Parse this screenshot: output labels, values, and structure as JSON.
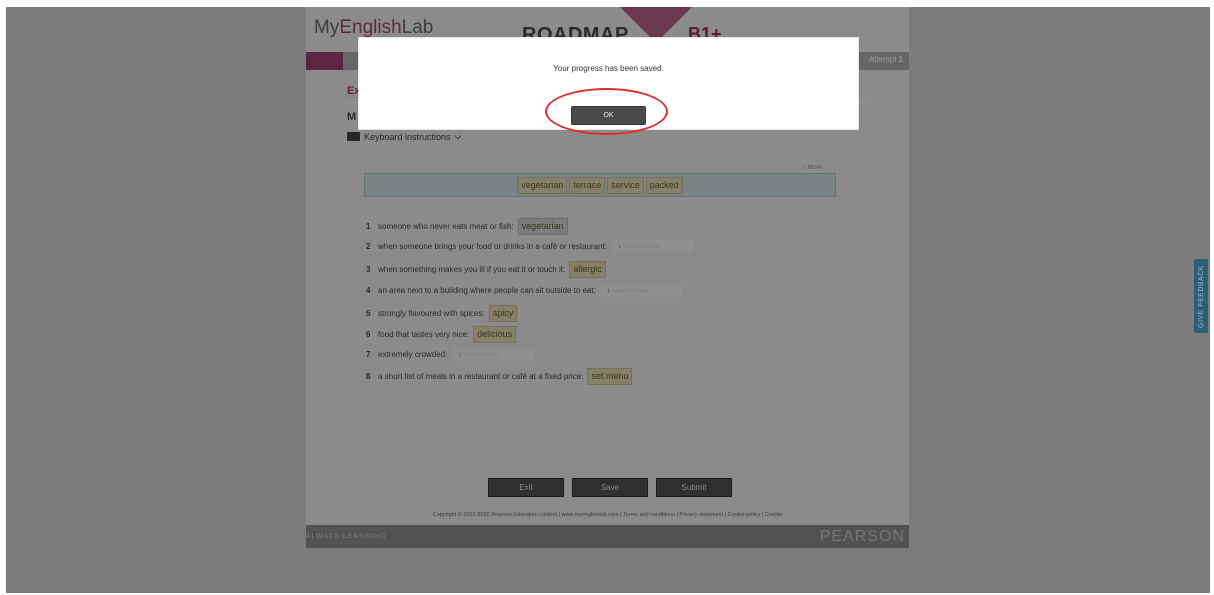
{
  "header": {
    "logo_prefix": "My",
    "logo_accent": "English",
    "logo_suffix": "Lab",
    "course": "ROADMAP",
    "level": "B1+"
  },
  "nav": {
    "attempt_label": "Attempt",
    "attempt_number": "1"
  },
  "exercise": {
    "title": "Ex",
    "instruction": "M",
    "keyboard_instructions": "Keyboard instructions"
  },
  "word_bank": {
    "move_label": "Move",
    "words": [
      "vegetarian",
      "terrace",
      "service",
      "packed"
    ]
  },
  "items": [
    {
      "num": "1",
      "text": "someone who never eats meat or fish:",
      "answer": "vegetarian"
    },
    {
      "num": "2",
      "text": "when someone brings your food or drinks in a café or restaurant:",
      "answer": ""
    },
    {
      "num": "3",
      "text": "when something makes you ill if you eat it or touch it:",
      "answer": "allergic"
    },
    {
      "num": "4",
      "text": "an area next to a building where people can sit outside to eat:",
      "answer": ""
    },
    {
      "num": "5",
      "text": "strongly flavoured with spices:",
      "answer": "spicy"
    },
    {
      "num": "6",
      "text": "food that tastes very nice:",
      "answer": "delicious"
    },
    {
      "num": "7",
      "text": "extremely crowded:",
      "answer": ""
    },
    {
      "num": "8",
      "text": "a short list of meals in a restaurant or café at a fixed price:",
      "answer": "set menu"
    }
  ],
  "drop_placeholder": "DRAG ITEM HERE",
  "actions": {
    "exit": "Exit",
    "save": "Save",
    "submit": "Submit"
  },
  "footer": {
    "copyright": "Copyright © 2012-2020 Pearson Education Limited | www.myenglishlab.com | Terms and conditions | Privacy statement | Cookie policy | Credits",
    "tagline": "ALWAYS LEARNING",
    "brand": "PEARSON"
  },
  "feedback": "GIVE FEEDBACK",
  "modal": {
    "message": "Your progress has been saved.",
    "ok": "OK"
  },
  "colors": {
    "accent": "#8b1a4a",
    "annotation": "#d9302f",
    "feedback_tab": "#2a5f78"
  }
}
